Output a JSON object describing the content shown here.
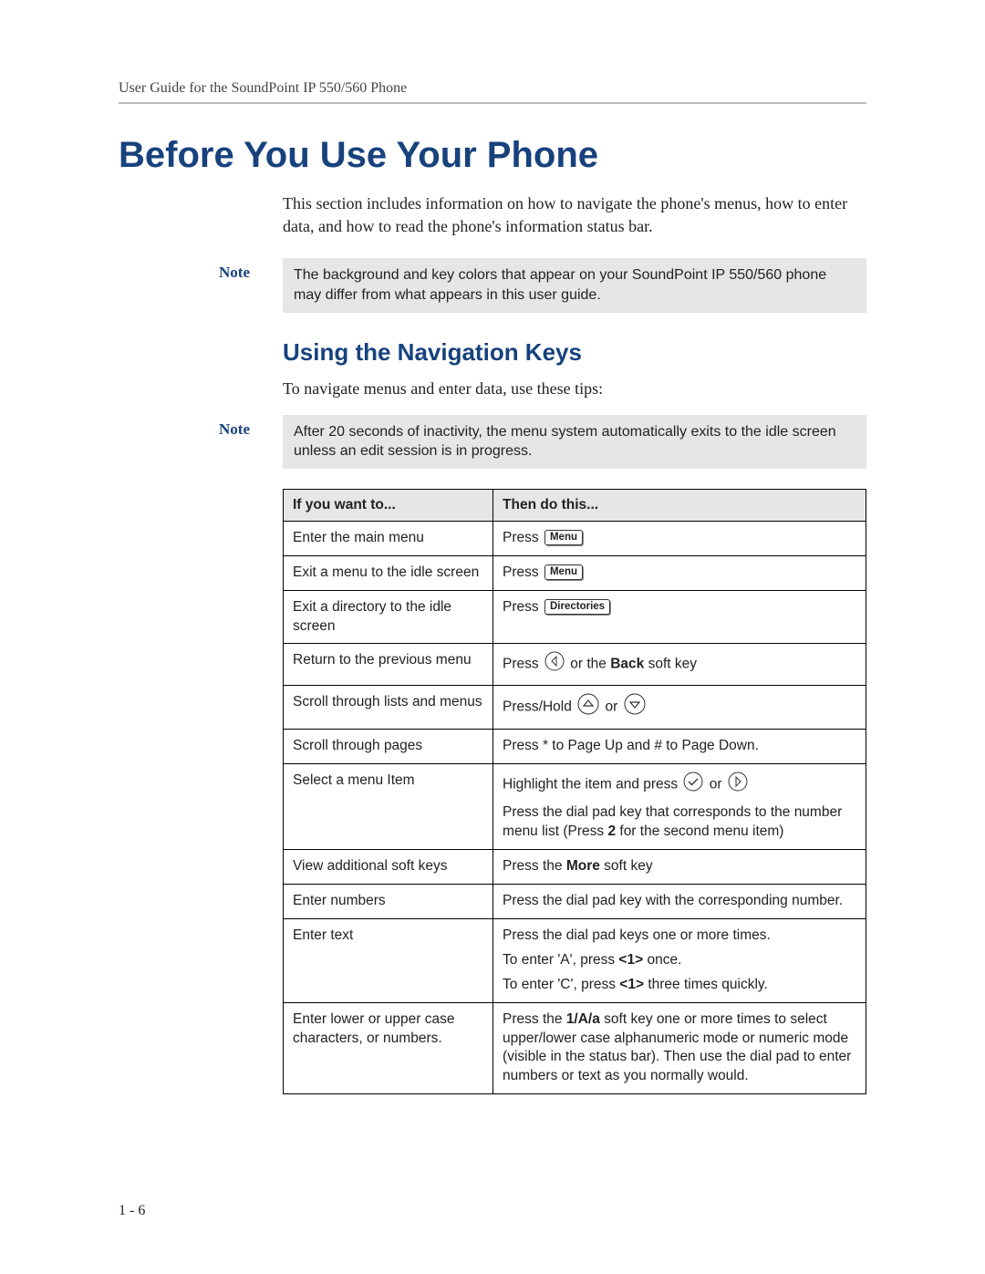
{
  "running_head": "User Guide for the SoundPoint IP 550/560 Phone",
  "section_title": "Before You Use Your Phone",
  "intro": "This section includes information on how to navigate the phone's menus, how to enter data, and how to read the phone's information status bar.",
  "note1_label": "Note",
  "note1_body": "The background and key colors that appear on your SoundPoint IP 550/560 phone may differ from what appears in this user guide.",
  "subsection": "Using the Navigation Keys",
  "tips_line": "To navigate menus and enter data, use these tips:",
  "note2_label": "Note",
  "note2_body": "After 20 seconds of inactivity, the menu system automatically exits to the idle screen unless an edit session is in progress.",
  "table": {
    "head_want": "If you want to...",
    "head_do": "Then do this...",
    "rows": {
      "r1_want": "Enter the main menu",
      "r1_do_press": "Press ",
      "r1_do_key": "Menu",
      "r2_want": "Exit a menu to the idle screen",
      "r2_do_press": "Press ",
      "r2_do_key": "Menu",
      "r3_want": "Exit a directory to the idle screen",
      "r3_do_press": "Press ",
      "r3_do_key": "Directories",
      "r4_want": "Return to the previous menu",
      "r4_do_pre": "Press ",
      "r4_do_mid": " or the ",
      "r4_do_bold": "Back",
      "r4_do_post": " soft key",
      "r5_want": "Scroll through lists and menus",
      "r5_do_pre": "Press/Hold ",
      "r5_do_or": " or ",
      "r6_want": "Scroll through pages",
      "r6_do": "Press * to Page Up and # to Page Down.",
      "r7_want": "Select a menu Item",
      "r7_do_pre": "Highlight the item and press ",
      "r7_do_or": " or ",
      "r7_do_p2a": "Press the dial pad key that corresponds to the number menu list (Press ",
      "r7_do_p2b": "2",
      "r7_do_p2c": " for the second menu item)",
      "r8_want": "View additional soft keys",
      "r8_do_pre": "Press the ",
      "r8_do_bold": "More",
      "r8_do_post": " soft key",
      "r9_want": "Enter numbers",
      "r9_do": "Press the dial pad key with the corresponding number.",
      "r10_want": "Enter text",
      "r10_do_l1": "Press the dial pad keys one or more times.",
      "r10_do_l2a": "To enter 'A', press ",
      "r10_do_l2b": "<1>",
      "r10_do_l2c": " once.",
      "r10_do_l3a": "To enter 'C', press ",
      "r10_do_l3b": "<1>",
      "r10_do_l3c": " three times quickly.",
      "r11_want": "Enter lower or upper case characters, or numbers.",
      "r11_do_a": "Press the ",
      "r11_do_b": "1/A/a",
      "r11_do_c": " soft key one or more times to select upper/lower case alphanumeric mode or numeric mode (visible in the status bar). Then use the dial pad to enter numbers or text as you normally would."
    }
  },
  "page_number": "1 - 6",
  "icons": {
    "menu": "Menu",
    "directories": "Directories"
  }
}
